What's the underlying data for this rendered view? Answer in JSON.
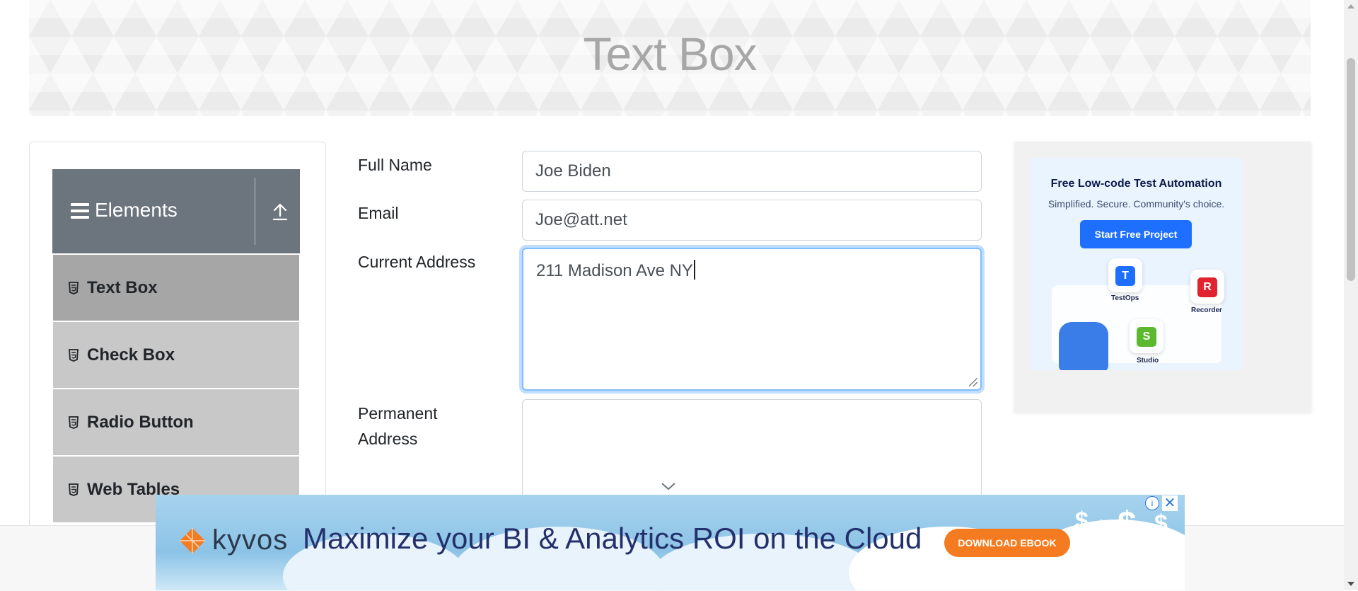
{
  "page": {
    "title": "Text Box"
  },
  "sidebar": {
    "group_title": "Elements",
    "items": [
      {
        "label": "Text Box",
        "active": true
      },
      {
        "label": "Check Box",
        "active": false
      },
      {
        "label": "Radio Button",
        "active": false
      },
      {
        "label": "Web Tables",
        "active": false
      }
    ]
  },
  "form": {
    "full_name": {
      "label": "Full Name",
      "value": "Joe Biden"
    },
    "email": {
      "label": "Email",
      "value": "Joe@att.net"
    },
    "current_address": {
      "label": "Current Address",
      "value": "211 Madison Ave NY"
    },
    "permanent_address": {
      "label_line1": "Permanent",
      "label_line2": "Address",
      "value": ""
    }
  },
  "side_ad": {
    "title": "Free Low-code Test Automation",
    "subtitle": "Simplified. Secure. Community's choice.",
    "cta": "Start Free Project",
    "tiles": [
      {
        "letter": "T",
        "caption": "TestOps",
        "color": "#1f6fff"
      },
      {
        "letter": "R",
        "caption": "Recorder",
        "color": "#e0232e"
      },
      {
        "letter": "S",
        "caption": "Studio",
        "color": "#5cb82f"
      }
    ]
  },
  "bottom_ad": {
    "brand": "kyvos",
    "headline": "Maximize your BI & Analytics ROI on the Cloud",
    "cta": "DOWNLOAD EBOOK",
    "info_glyph": "i",
    "close_glyph": "✕",
    "brand_color": "#f47b20"
  },
  "colors": {
    "group_header": "#6c757d",
    "menu_item": "#c8c8c8",
    "menu_item_active": "#a6a6a6",
    "focus_border": "#80bdff"
  }
}
